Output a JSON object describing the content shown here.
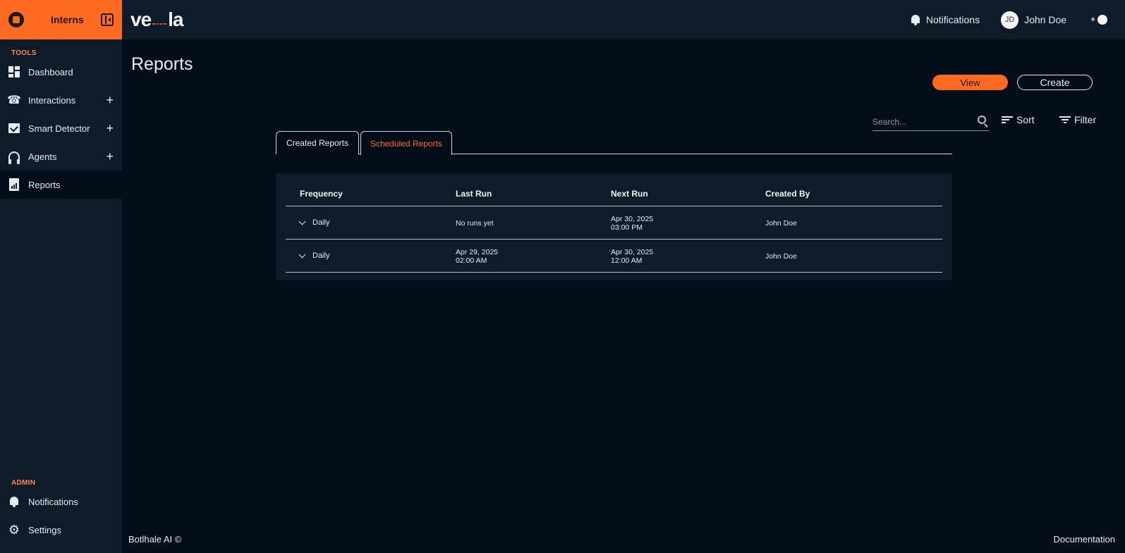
{
  "org": {
    "name": "Interns"
  },
  "brand": {
    "name_left": "ve",
    "name_right": "la"
  },
  "sidebar": {
    "tools_label": "TOOLS",
    "tools": [
      {
        "label": "Dashboard",
        "icon": "dashboard-icon"
      },
      {
        "label": "Interactions",
        "icon": "phone-icon",
        "expandable": "+"
      },
      {
        "label": "Smart Detector",
        "icon": "chart-icon",
        "expandable": "+"
      },
      {
        "label": "Agents",
        "icon": "headset-icon",
        "expandable": "+"
      },
      {
        "label": "Reports",
        "icon": "report-icon",
        "active": true
      }
    ],
    "admin_label": "ADMIN",
    "admin": [
      {
        "label": "Notifications",
        "icon": "bell-icon"
      },
      {
        "label": "Settings",
        "icon": "gear-icon"
      }
    ]
  },
  "topbar": {
    "notifications_label": "Notifications",
    "user": {
      "initials": "JD",
      "name": "John Doe"
    }
  },
  "main": {
    "title": "Reports",
    "view_label": "View",
    "create_label": "Create",
    "search_placeholder": "Search...",
    "sort_label": "Sort",
    "filter_label": "Filter",
    "tabs": [
      {
        "label": "Created Reports",
        "active": false
      },
      {
        "label": "Scheduled Reports",
        "active": true
      }
    ],
    "table": {
      "headers": [
        "Frequency",
        "Last Run",
        "Next Run",
        "Created By"
      ],
      "rows": [
        {
          "frequency": "Daily",
          "last_run": [
            "No runs yet"
          ],
          "next_run": [
            "Apr 30, 2025",
            "03:00 PM"
          ],
          "created_by": "John Doe"
        },
        {
          "frequency": "Daily",
          "last_run": [
            "Apr 29, 2025",
            "02:00 AM"
          ],
          "next_run": [
            "Apr 30, 2025",
            "12:00 AM"
          ],
          "created_by": "John Doe"
        }
      ]
    }
  },
  "footer": {
    "left": "Botlhale AI ©",
    "right": "Documentation"
  },
  "colors": {
    "accent": "#ff6a22",
    "sidebar_bg": "#0e1b29",
    "page_bg": "#030e18"
  }
}
